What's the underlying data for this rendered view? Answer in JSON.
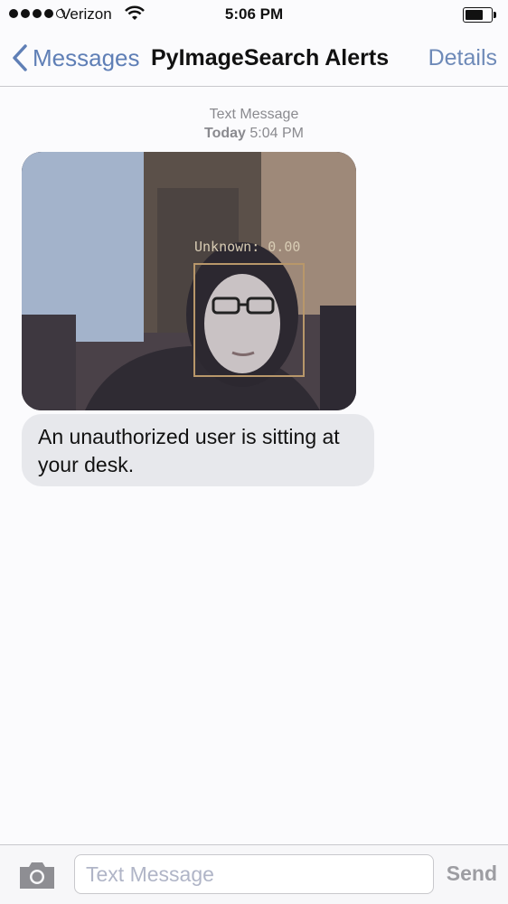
{
  "status_bar": {
    "signal_bars_filled": 4,
    "signal_bars_total": 5,
    "carrier": "Verizon",
    "time": "5:06 PM",
    "battery_level": 0.7
  },
  "nav": {
    "back_label": "Messages",
    "title": "PyImageSearch Alerts",
    "details_label": "Details"
  },
  "thread": {
    "timestamp_label": "Text Message",
    "timestamp_day": "Today",
    "timestamp_time": "5:04 PM",
    "photo_overlay_label": "Unknown: 0.00",
    "message_text": "An unauthorized user is sitting at your desk."
  },
  "input_bar": {
    "placeholder": "Text Message",
    "send_label": "Send"
  },
  "colors": {
    "accent": "#5f7fb6",
    "bubble": "#e7e8ec",
    "box": "#b8976a"
  }
}
